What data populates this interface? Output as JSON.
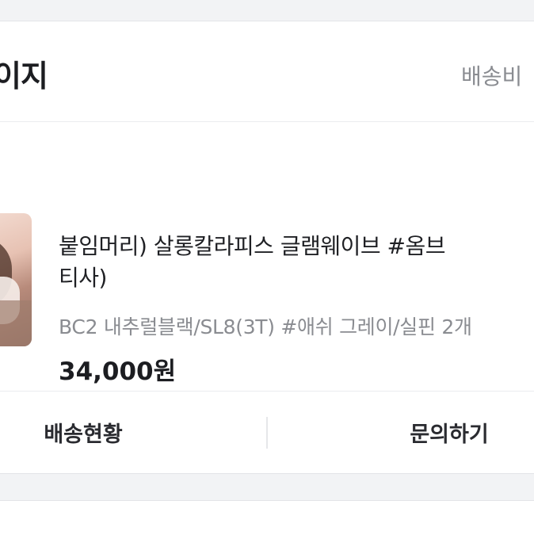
{
  "header": {
    "title": "이지",
    "shipping_fee_label": "배송비"
  },
  "order": {
    "status": "!",
    "product": {
      "name_line1": "붙임머리) 살롱칼라피스 글램웨이브 #옴브",
      "name_line2": "티사)",
      "option": "BC2 내추럴블랙/SL8(3T) #애쉬 그레이/실핀 2개",
      "price": "34,000원"
    }
  },
  "actions": {
    "tracking_label": "배송현황",
    "inquiry_label": "문의하기"
  },
  "colors": {
    "status_green": "#35c36b",
    "muted_text": "#8a8c91",
    "background": "#f2f3f5"
  }
}
